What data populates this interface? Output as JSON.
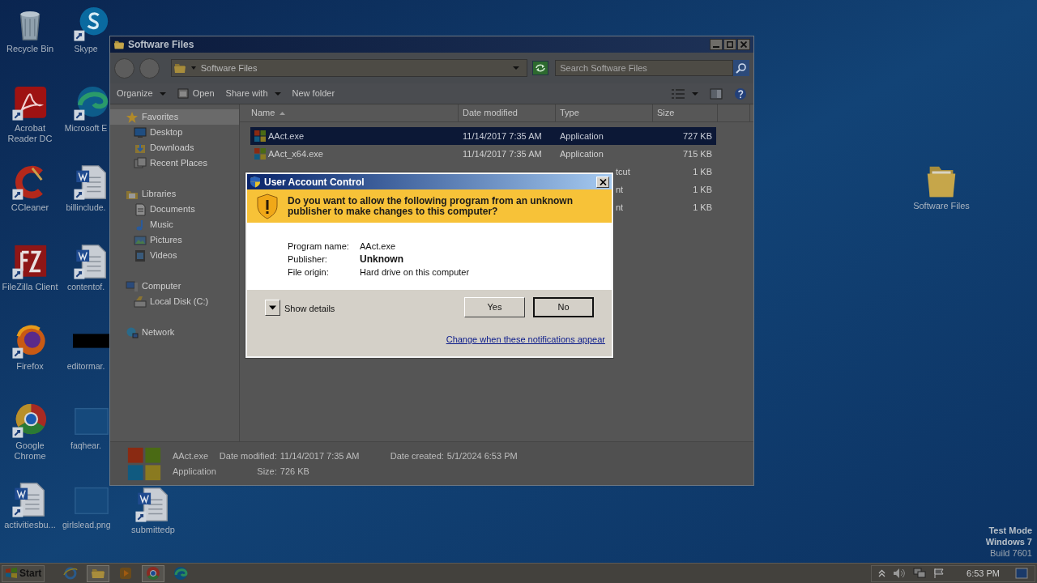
{
  "desktop": {
    "columns": [
      {
        "icons": [
          {
            "label": "Recycle Bin",
            "kind": "recycle"
          },
          {
            "label": "Acrobat Reader DC",
            "kind": "acrobat"
          },
          {
            "label": "CCleaner",
            "kind": "ccleaner"
          },
          {
            "label": "FileZilla Client",
            "kind": "filezilla"
          },
          {
            "label": "Firefox",
            "kind": "firefox"
          },
          {
            "label": "Google Chrome",
            "kind": "chrome"
          },
          {
            "label": "activitiesbu...",
            "kind": "word"
          }
        ]
      },
      {
        "icons": [
          {
            "label": "Skype",
            "kind": "skype"
          },
          {
            "label": "Microsoft E",
            "kind": "edge"
          },
          {
            "label": "billinclude.",
            "kind": "word"
          },
          {
            "label": "contentof.",
            "kind": "word"
          },
          {
            "label": "editormar.",
            "kind": "black-thumb"
          },
          {
            "label": "faqhear.",
            "kind": "faint-thumb"
          },
          {
            "label": "girlslead.png",
            "kind": "faint-thumb"
          }
        ]
      },
      {
        "icons": [
          {
            "label": "submittedp",
            "kind": "word"
          }
        ]
      }
    ],
    "right_icons": [
      {
        "label": "Software Files",
        "kind": "folder"
      }
    ],
    "notice": [
      "Test Mode",
      "Windows 7",
      "Build 7601"
    ]
  },
  "explorer": {
    "title": "Software Files",
    "address": "Software Files",
    "search_placeholder": "Search Software Files",
    "toolbar": [
      {
        "label": "Organize",
        "kind": "menu"
      },
      {
        "label": "Open",
        "kind": "open"
      },
      {
        "label": "Share with",
        "kind": "menu"
      },
      {
        "label": "New folder",
        "kind": "plain"
      }
    ],
    "nav": [
      {
        "label": "Favorites",
        "kind": "star",
        "selected": true,
        "children": [
          {
            "label": "Desktop",
            "kind": "desktop",
            "selected": false
          },
          {
            "label": "Downloads",
            "kind": "downloads",
            "selected": false
          },
          {
            "label": "Recent Places",
            "kind": "recent",
            "selected": false
          }
        ]
      },
      {
        "label": "Libraries",
        "kind": "libraries",
        "selected": false,
        "children": [
          {
            "label": "Documents",
            "kind": "documents",
            "selected": false
          },
          {
            "label": "Music",
            "kind": "music",
            "selected": false
          },
          {
            "label": "Pictures",
            "kind": "pictures",
            "selected": false
          },
          {
            "label": "Videos",
            "kind": "videos",
            "selected": false
          }
        ]
      },
      {
        "label": "Computer",
        "kind": "computer",
        "selected": false,
        "children": [
          {
            "label": "Local Disk (C:)",
            "kind": "disk",
            "selected": false
          }
        ]
      },
      {
        "label": "Network",
        "kind": "network",
        "selected": false
      }
    ],
    "columns": [
      {
        "label": "Name",
        "sorted": true
      },
      {
        "label": "Date modified",
        "sorted": false
      },
      {
        "label": "Type",
        "sorted": false
      },
      {
        "label": "Size",
        "sorted": false
      }
    ],
    "rows": [
      {
        "kind": "file",
        "name": "AAct.exe",
        "date": "11/14/2017 7:35 AM",
        "type": "Application",
        "size": "727 KB",
        "selected": true
      },
      {
        "kind": "file",
        "name": "AAct_x64.exe",
        "date": "11/14/2017 7:35 AM",
        "type": "Application",
        "size": "715 KB",
        "selected": false
      },
      {
        "kind": "covered",
        "type": "tcut",
        "size": "1 KB",
        "selected": false
      },
      {
        "kind": "covered",
        "type": "nt",
        "size": "1 KB",
        "selected": false
      },
      {
        "kind": "covered",
        "type": "nt",
        "size": "1 KB",
        "selected": false
      }
    ],
    "details": {
      "name": "AAct.exe",
      "type": "Application",
      "fields": [
        {
          "label": "Date modified:",
          "value": "11/14/2017 7:35 AM"
        },
        {
          "label": "Date created:",
          "value": "5/1/2024 6:53 PM"
        },
        {
          "label": "Size:",
          "value": "726 KB"
        }
      ]
    }
  },
  "uac": {
    "title": "User Account Control",
    "question": "Do you want to allow the following program from an unknown publisher to make changes to this computer?",
    "fields": [
      {
        "label": "Program name:",
        "value": "AAct.exe",
        "bold": false
      },
      {
        "label": "Publisher:",
        "value": "Unknown",
        "bold": true
      },
      {
        "label": "File origin:",
        "value": "Hard drive on this computer",
        "bold": false
      }
    ],
    "details_label": "Show details",
    "buttons": [
      {
        "label": "Yes",
        "focused": false
      },
      {
        "label": "No",
        "focused": true
      }
    ],
    "link": "Change when these notifications appear"
  },
  "taskbar": {
    "start": "Start",
    "apps": [
      {
        "kind": "ie",
        "active": false
      },
      {
        "kind": "explorer",
        "active": true
      },
      {
        "kind": "media",
        "active": false
      },
      {
        "kind": "chrome",
        "active": true
      },
      {
        "kind": "edge",
        "active": false
      }
    ],
    "clock": "6:53 PM"
  }
}
